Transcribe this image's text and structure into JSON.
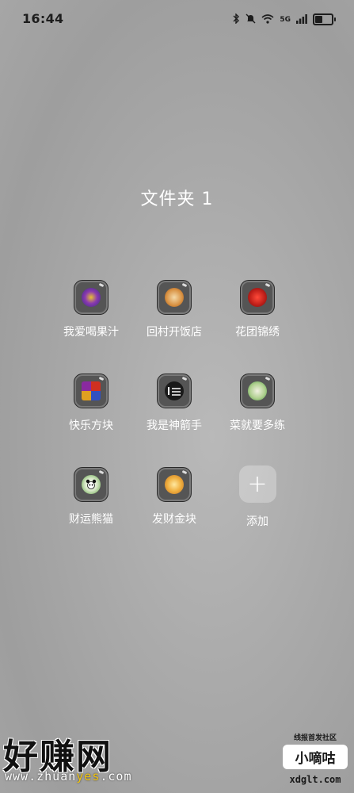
{
  "status_bar": {
    "time": "16:44",
    "network": "5G",
    "icons": [
      "bluetooth-icon",
      "mute-icon",
      "wifi-icon",
      "signal-icon",
      "battery-icon"
    ]
  },
  "folder": {
    "title": "文件夹 1",
    "apps": [
      {
        "label": "我爱喝果汁",
        "icon": "juice-app-icon",
        "color": "#5b3a9a"
      },
      {
        "label": "回村开饭店",
        "icon": "restaurant-app-icon",
        "color": "#e0a040"
      },
      {
        "label": "花团锦绣",
        "icon": "flower-app-icon",
        "color": "#c0201a"
      },
      {
        "label": "快乐方块",
        "icon": "blocks-app-icon",
        "color": "#d04020"
      },
      {
        "label": "我是神箭手",
        "icon": "archer-app-icon",
        "color": "#222222"
      },
      {
        "label": "菜就要多练",
        "icon": "practice-app-icon",
        "color": "#4a9a40"
      },
      {
        "label": "财运熊猫",
        "icon": "panda-app-icon",
        "color": "#5aa040"
      },
      {
        "label": "发财金块",
        "icon": "gold-app-icon",
        "color": "#e0902a"
      }
    ],
    "add_label": "添加",
    "add_symbol": "+"
  },
  "watermark": {
    "left_text": "好赚网",
    "left_url_prefix": "www.zhuan",
    "left_url_highlight": "yes",
    "left_url_suffix": ".com",
    "right_top": "线报首发社区",
    "right_mid": "小嘀咕",
    "right_bottom": "xdglt.com"
  }
}
